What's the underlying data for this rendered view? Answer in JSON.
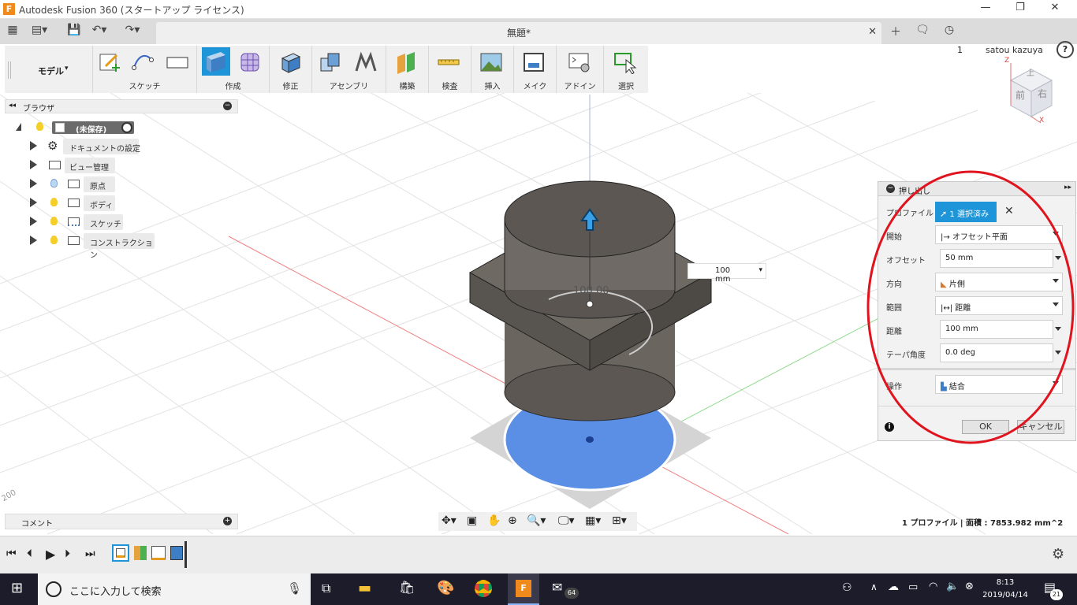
{
  "window": {
    "title": "Autodesk Fusion 360 (スタートアップ ライセンス)",
    "app_icon": "F"
  },
  "tabbar": {
    "doc_title": "無題*",
    "job_count": "1",
    "user": "satou kazuya"
  },
  "workspace": {
    "label": "モデル"
  },
  "toolbar": {
    "groups": [
      "スケッチ",
      "作成",
      "修正",
      "アセンブリ",
      "構築",
      "検査",
      "挿入",
      "メイク",
      "アドイン",
      "選択"
    ]
  },
  "browser": {
    "title": "ブラウザ",
    "root": "(未保存)",
    "items": [
      "ドキュメントの設定",
      "ビュー管理",
      "原点",
      "ボディ",
      "スケッチ",
      "コンストラクション"
    ]
  },
  "viewcube": {
    "front": "前",
    "right": "右",
    "top": "上",
    "axis_z": "Z",
    "axis_x": "X"
  },
  "viewport": {
    "dimension_label": "100.00",
    "value_box": "100 mm",
    "grid_label": "200"
  },
  "extrude_dialog": {
    "title": "押し出し",
    "profile_label": "プロファイル",
    "profile_value": "1 選択済み",
    "start_label": "開始",
    "start_value": "オフセット平面",
    "offset_label": "オフセット",
    "offset_value": "50 mm",
    "direction_label": "方向",
    "direction_value": "片側",
    "extent_label": "範囲",
    "extent_value": "距離",
    "distance_label": "距離",
    "distance_value": "100 mm",
    "taper_label": "テーパ角度",
    "taper_value": "0.0 deg",
    "operation_label": "操作",
    "operation_value": "結合",
    "ok": "OK",
    "cancel": "キャンセル"
  },
  "comment": {
    "label": "コメント"
  },
  "status": {
    "text": "1 プロファイル | 面積 : 7853.982 mm^2"
  },
  "taskbar": {
    "search_placeholder": "ここに入力して検索",
    "time": "8:13",
    "date": "2019/04/14",
    "mail_badge": "64",
    "notif_badge": "21"
  },
  "colors": {
    "accent": "#1d95d8",
    "highlight_ring": "#e0141e",
    "profile_fill": "#3d7de0",
    "body": "#5e5a55"
  }
}
